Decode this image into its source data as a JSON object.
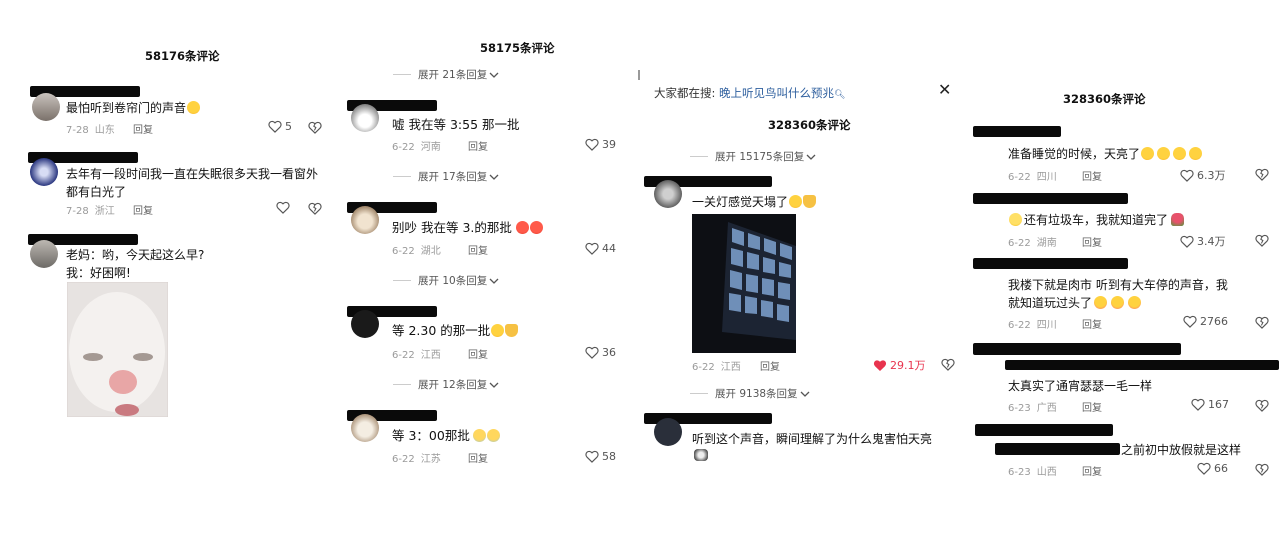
{
  "panels": [
    {
      "title": "58176条评论",
      "comments": [
        {
          "text": "最怕听到卷帘门的声音",
          "date": "7-28",
          "location": "山东",
          "reply": "回复",
          "likes": "5"
        },
        {
          "text": "去年有一段时间我一直在失眠很多天我一看窗外都有白光了",
          "date": "7-28",
          "location": "浙江",
          "reply": "回复",
          "likes": ""
        },
        {
          "text_line1": "老妈：哟，今天起这么早?",
          "text_line2": "我：好困啊!"
        }
      ]
    },
    {
      "title": "58175条评论",
      "expands": [
        "展开 21条回复",
        "展开 17条回复",
        "展开 10条回复",
        "展开 12条回复"
      ],
      "comments": [
        {
          "text": "嘘 我在等 3:55 那一批",
          "date": "6-22",
          "location": "河南",
          "reply": "回复",
          "likes": "39"
        },
        {
          "text": "别吵 我在等 3.的那批",
          "date": "6-22",
          "location": "湖北",
          "reply": "回复",
          "likes": "44"
        },
        {
          "text": "等 2.30 的那一批",
          "date": "6-22",
          "location": "江西",
          "reply": "回复",
          "likes": "36"
        },
        {
          "text": "等 3：00那批",
          "date": "6-22",
          "location": "江苏",
          "reply": "回复",
          "likes": "58"
        }
      ]
    },
    {
      "search_prefix": "大家都在搜:",
      "search_term": "晚上听见鸟叫什么预兆",
      "title": "328360条评论",
      "expands": [
        "展开 15175条回复",
        "展开 9138条回复"
      ],
      "comments": [
        {
          "text": "一关灯感觉天塌了",
          "date": "6-22",
          "location": "江西",
          "reply": "回复",
          "likes": "29.1万"
        },
        {
          "text": "听到这个声音，瞬间理解了为什么鬼害怕天亮"
        }
      ]
    },
    {
      "title": "328360条评论",
      "comments": [
        {
          "text": "准备睡觉的时候，天亮了",
          "date": "6-22",
          "location": "四川",
          "reply": "回复",
          "likes": "6.3万"
        },
        {
          "text": "还有垃圾车，我就知道完了",
          "date": "6-22",
          "location": "湖南",
          "reply": "回复",
          "likes": "3.4万"
        },
        {
          "text_line1": "我楼下就是肉市 听到有大车停的声音，我",
          "text_line2": "就知道玩过头了",
          "date": "6-22",
          "location": "四川",
          "reply": "回复",
          "likes": "2766"
        },
        {
          "text": "太真实了通宵瑟瑟一毛一样",
          "date": "6-23",
          "location": "广西",
          "reply": "回复",
          "likes": "167"
        },
        {
          "text": "之前初中放假就是这样",
          "date": "6-23",
          "location": "山西",
          "reply": "回复",
          "likes": "66"
        }
      ]
    }
  ],
  "colors": {
    "liked": "#e8344e",
    "search_blue": "#2e5f9e",
    "muted": "#9a9a9a"
  }
}
